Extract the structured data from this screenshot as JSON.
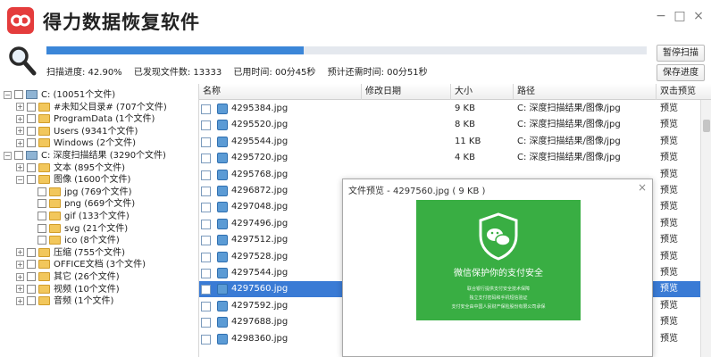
{
  "app": {
    "title": "得力数据恢复软件"
  },
  "scan": {
    "progress_fraction": 0.429,
    "progress_label": "扫描进度: 42.90%",
    "found_label": "已发现文件数: 13333",
    "elapsed_label": "已用时间: 00分45秒",
    "remaining_label": "预计还需时间: 00分51秒",
    "pause_button": "暂停扫描",
    "save_button": "保存进度"
  },
  "tree": {
    "items": [
      {
        "label": "C:  (10051个文件)",
        "level": 0,
        "expander": "−",
        "icon": "drive"
      },
      {
        "label": "#未知父目录# (707个文件)",
        "level": 1,
        "expander": "+",
        "icon": "folder"
      },
      {
        "label": "ProgramData  (1个文件)",
        "level": 1,
        "expander": "+",
        "icon": "folder"
      },
      {
        "label": "Users  (9341个文件)",
        "level": 1,
        "expander": "+",
        "icon": "folder"
      },
      {
        "label": "Windows  (2个文件)",
        "level": 1,
        "expander": "+",
        "icon": "folder"
      },
      {
        "label": "C: 深度扫描结果 (3290个文件)",
        "level": 0,
        "expander": "−",
        "icon": "drive"
      },
      {
        "label": "文本  (895个文件)",
        "level": 1,
        "expander": "+",
        "icon": "folder"
      },
      {
        "label": "图像  (1600个文件)",
        "level": 1,
        "expander": "−",
        "icon": "folder"
      },
      {
        "label": "jpg  (769个文件)",
        "level": 2,
        "expander": "",
        "icon": "folder"
      },
      {
        "label": "png  (669个文件)",
        "level": 2,
        "expander": "",
        "icon": "folder"
      },
      {
        "label": "gif  (133个文件)",
        "level": 2,
        "expander": "",
        "icon": "folder"
      },
      {
        "label": "svg  (21个文件)",
        "level": 2,
        "expander": "",
        "icon": "folder"
      },
      {
        "label": "ico  (8个文件)",
        "level": 2,
        "expander": "",
        "icon": "folder"
      },
      {
        "label": "压缩  (755个文件)",
        "level": 1,
        "expander": "+",
        "icon": "folder"
      },
      {
        "label": "OFFICE文档  (3个文件)",
        "level": 1,
        "expander": "+",
        "icon": "folder"
      },
      {
        "label": "其它  (26个文件)",
        "level": 1,
        "expander": "+",
        "icon": "folder"
      },
      {
        "label": "视频  (10个文件)",
        "level": 1,
        "expander": "+",
        "icon": "folder"
      },
      {
        "label": "音频  (1个文件)",
        "level": 1,
        "expander": "+",
        "icon": "folder"
      }
    ]
  },
  "table": {
    "columns": [
      "名称",
      "修改日期",
      "大小",
      "路径",
      "双击预览"
    ],
    "rows": [
      {
        "name": "4295384.jpg",
        "date": "",
        "size": "9 KB",
        "path": "C: 深度扫描结果/图像/jpg",
        "preview": "预览",
        "selected": false
      },
      {
        "name": "4295520.jpg",
        "date": "",
        "size": "8 KB",
        "path": "C: 深度扫描结果/图像/jpg",
        "preview": "预览",
        "selected": false
      },
      {
        "name": "4295544.jpg",
        "date": "",
        "size": "11 KB",
        "path": "C: 深度扫描结果/图像/jpg",
        "preview": "预览",
        "selected": false
      },
      {
        "name": "4295720.jpg",
        "date": "",
        "size": "4 KB",
        "path": "C: 深度扫描结果/图像/jpg",
        "preview": "预览",
        "selected": false
      },
      {
        "name": "4295768.jpg",
        "date": "",
        "size": "",
        "path": "",
        "preview": "预览",
        "selected": false
      },
      {
        "name": "4296872.jpg",
        "date": "",
        "size": "",
        "path": "",
        "preview": "预览",
        "selected": false
      },
      {
        "name": "4297048.jpg",
        "date": "",
        "size": "",
        "path": "",
        "preview": "预览",
        "selected": false
      },
      {
        "name": "4297496.jpg",
        "date": "",
        "size": "",
        "path": "",
        "preview": "预览",
        "selected": false
      },
      {
        "name": "4297512.jpg",
        "date": "",
        "size": "",
        "path": "",
        "preview": "预览",
        "selected": false
      },
      {
        "name": "4297528.jpg",
        "date": "",
        "size": "",
        "path": "",
        "preview": "预览",
        "selected": false
      },
      {
        "name": "4297544.jpg",
        "date": "",
        "size": "",
        "path": "",
        "preview": "预览",
        "selected": false
      },
      {
        "name": "4297560.jpg",
        "date": "",
        "size": "",
        "path": "",
        "preview": "预览",
        "selected": true
      },
      {
        "name": "4297592.jpg",
        "date": "",
        "size": "",
        "path": "",
        "preview": "预览",
        "selected": false
      },
      {
        "name": "4297688.jpg",
        "date": "",
        "size": "",
        "path": "",
        "preview": "预览",
        "selected": false
      },
      {
        "name": "4298360.jpg",
        "date": "",
        "size": "",
        "path": "",
        "preview": "预览",
        "selected": false
      }
    ]
  },
  "preview": {
    "title": "文件预览 - 4297560.jpg ( 9 KB )",
    "headline": "微信保护你的支付安全",
    "lines": [
      "联合银行提供支付安全技术保障",
      "独立支付密码和手机短信验证",
      "支付安全由中国人民财产保险股份有限公司承保"
    ]
  },
  "colors": {
    "accent": "#3b86d8",
    "selected_row": "#3a7bd5",
    "logo": "#e43c3c",
    "preview_green": "#39ae43"
  }
}
